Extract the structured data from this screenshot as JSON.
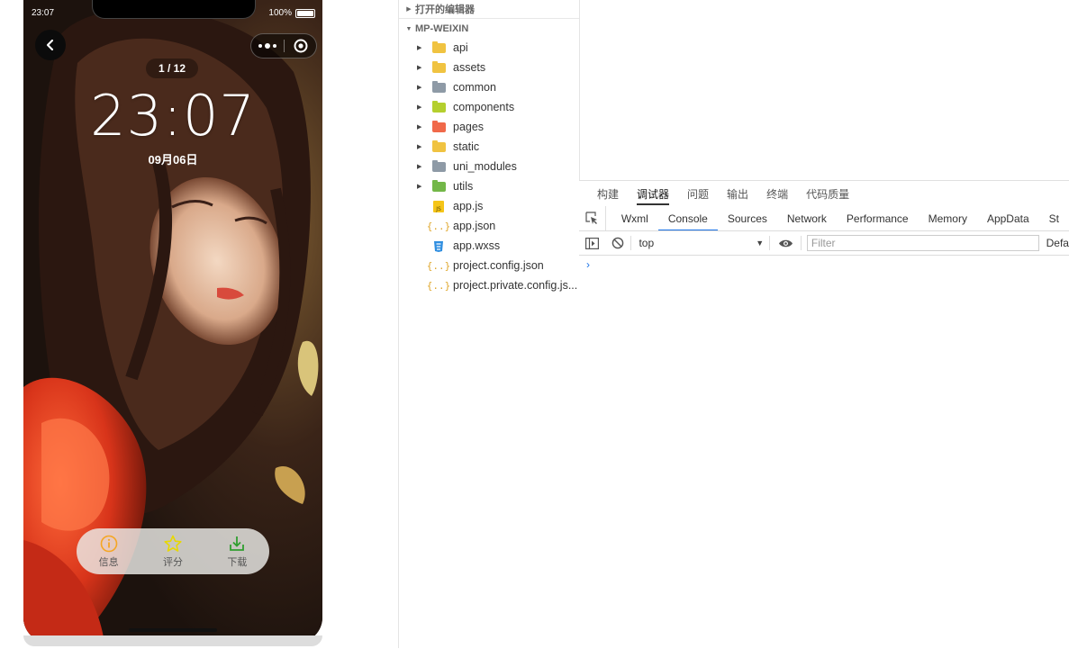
{
  "phone": {
    "status_time": "23:07",
    "battery": "100%",
    "pager": "1 / 12",
    "clock": "23:07",
    "date": "09月06日",
    "toolbar": [
      {
        "label": "信息",
        "icon": "info-icon",
        "color": "#f5a623"
      },
      {
        "label": "评分",
        "icon": "star-icon",
        "color": "#f2e600"
      },
      {
        "label": "下载",
        "icon": "download-icon",
        "color": "#2f9e2f"
      }
    ]
  },
  "explorer": {
    "open_editors": "打开的编辑器",
    "project": "MP-WEIXIN",
    "folders": [
      "api",
      "assets",
      "common",
      "components",
      "pages",
      "static",
      "uni_modules",
      "utils"
    ],
    "files": [
      "app.js",
      "app.json",
      "app.wxss",
      "project.config.json",
      "project.private.config.js..."
    ]
  },
  "debug": {
    "tabs": [
      "构建",
      "调试器",
      "问题",
      "输出",
      "终端",
      "代码质量"
    ],
    "active_tab": "调试器",
    "devtools_tabs": [
      "Wxml",
      "Console",
      "Sources",
      "Network",
      "Performance",
      "Memory",
      "AppData",
      "St"
    ],
    "active_devtools_tab": "Console",
    "context": "top",
    "filter_placeholder": "Filter",
    "levels": "Defa",
    "prompt": "›"
  },
  "colors": {
    "active_devtools_underline": "#1a73e8",
    "folder_api": "#f0c341",
    "folder_common": "#8e9aa6",
    "folder_components": "#b4cf2e",
    "folder_pages": "#f0694a",
    "folder_utils": "#73b748"
  }
}
